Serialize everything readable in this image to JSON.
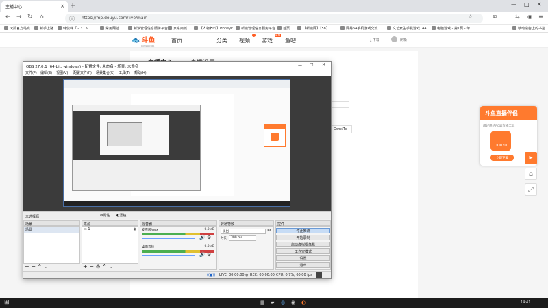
{
  "browser": {
    "tab_title": "主播中心",
    "url": "https://mp.douyu.com/live/main",
    "bookmarks": [
      "火狐官方站点",
      "新手上路",
      "韩俊峰「'-'ゞ`ゞ",
      "常用网址",
      "新浪管理信息服务平台",
      "京东商城",
      "【人物养料】HoneyE...",
      "新浪管理信息服务平台",
      "首页",
      "【新浪网】【58】",
      "网易64手机游戏交流...",
      "文艺女生手机游戏144...",
      "电脑游戏 - 第1页 - 单...",
      "移动设备上的书签"
    ]
  },
  "site": {
    "logo": "斗鱼",
    "logo_sub": "douyu.com",
    "nav": [
      "首页",
      "分类",
      "视频",
      "游戏",
      "鱼吧"
    ],
    "nav_badge": "直播",
    "download": "下载",
    "user": "刷新",
    "side_title": "主播中心",
    "live_title": "直播设置",
    "side_text": "OwnsTo"
  },
  "ad": {
    "title": "斗鱼直播伴侣",
    "subtitle": "最好用的PC端直播工具",
    "logo_text": "DOUYU",
    "button": "立即下载"
  },
  "obs": {
    "title": "OBS 27.0.1 (64-bit, windows) - 配置文件: 未命名 - 场景: 未命名",
    "menu": [
      "文件(F)",
      "编辑(E)",
      "视图(V)",
      "配置文件(P)",
      "场景集合(S)",
      "工具(T)",
      "帮助(H)"
    ],
    "source_label": "未选择源",
    "props_btn": "属性",
    "filters_btn": "滤镜",
    "docks": {
      "scenes": {
        "title": "场景",
        "items": [
          "场景"
        ]
      },
      "sources": {
        "title": "来源",
        "items": [
          "1"
        ]
      },
      "mixer": {
        "title": "混音器",
        "channels": [
          {
            "name": "麦克风/Aux",
            "db": "0.0 dB"
          },
          {
            "name": "桌面音频",
            "db": "0.0 dB"
          }
        ]
      },
      "transitions": {
        "title": "转场特效",
        "type": "淡出",
        "duration_label": "时长",
        "duration": "300 ms"
      },
      "controls": {
        "title": "控件",
        "buttons": [
          "停止推流",
          "开始录制",
          "启动虚拟摄像机",
          "工作室模式",
          "设置",
          "退出"
        ]
      }
    },
    "status": {
      "live": "LIVE: 00:00:00",
      "rec": "REC: 00:00:00",
      "cpu": "CPU: 0.7%, 60.00 fps"
    }
  },
  "taskbar": {
    "time": "14:41"
  },
  "colors": {
    "brand": "#ff5d23",
    "obs_bg": "#f0f0f0",
    "preview_bg": "#3b3b3b"
  }
}
